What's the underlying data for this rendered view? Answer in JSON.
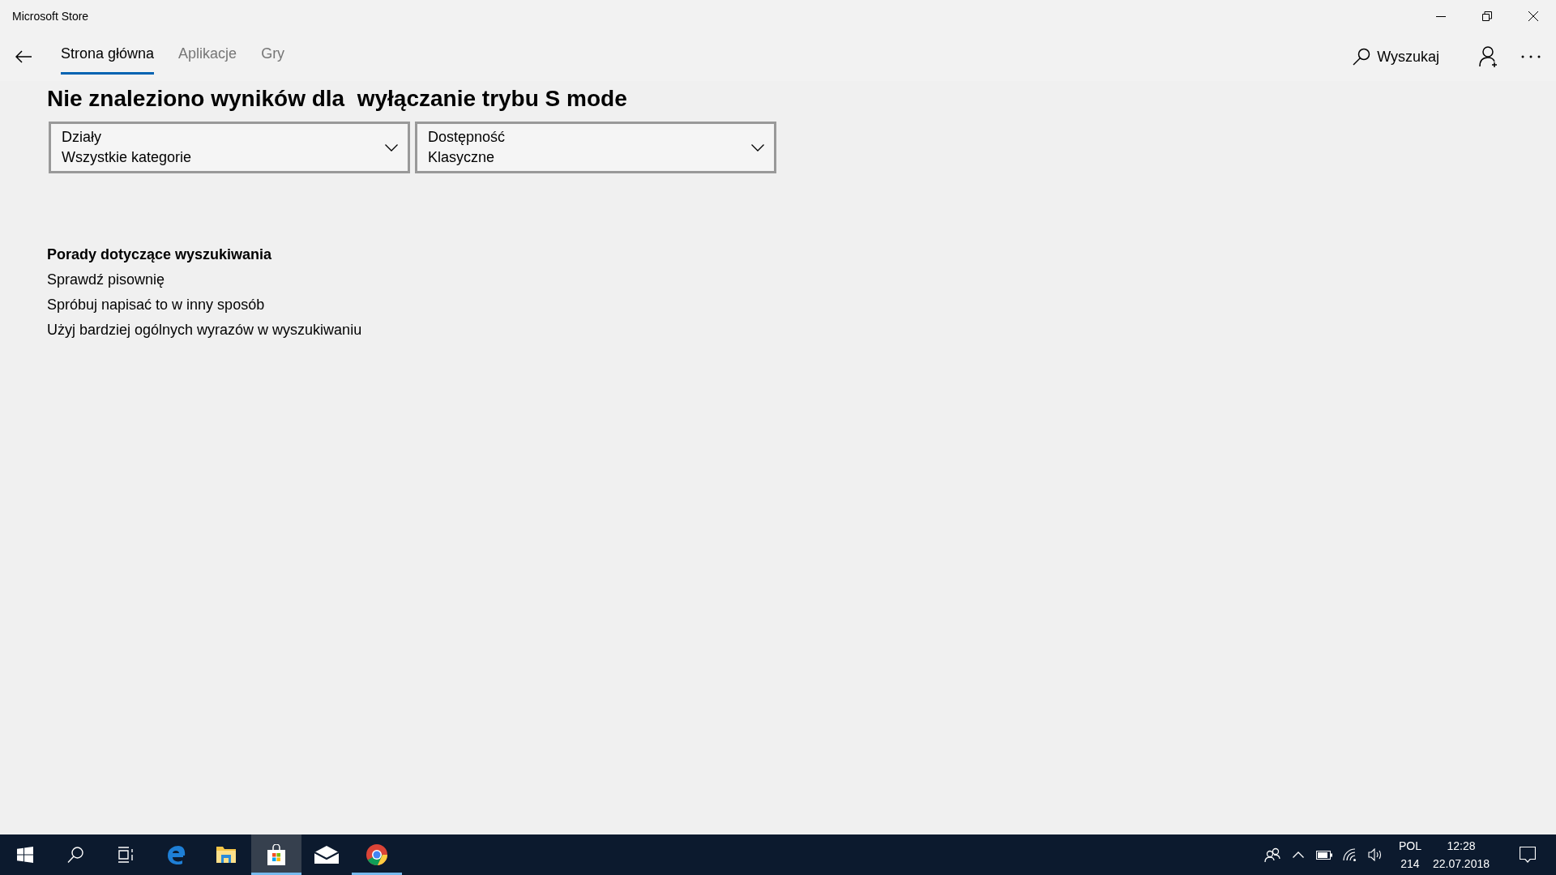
{
  "window": {
    "title": "Microsoft Store"
  },
  "tabs": [
    {
      "label": "Strona główna",
      "selected": true
    },
    {
      "label": "Aplikacje",
      "selected": false
    },
    {
      "label": "Gry",
      "selected": false
    }
  ],
  "search": {
    "label": "Wyszukaj"
  },
  "heading": "Nie znaleziono wyników dla  wyłączanie trybu S mode",
  "filters": [
    {
      "label": "Działy",
      "value": "Wszystkie kategorie"
    },
    {
      "label": "Dostępność",
      "value": "Klasyczne"
    }
  ],
  "tips": {
    "title": "Porady dotyczące wyszukiwania",
    "items": [
      "Sprawdź pisownię",
      "Spróbuj napisać to w inny sposób",
      "Użyj bardziej ogólnych wyrazów w wyszukiwaniu"
    ]
  },
  "taskbar": {
    "apps": [
      {
        "kind": "start",
        "active": false,
        "running": false
      },
      {
        "kind": "search",
        "active": false,
        "running": false
      },
      {
        "kind": "taskview",
        "active": false,
        "running": false
      },
      {
        "kind": "edge",
        "active": false,
        "running": false
      },
      {
        "kind": "explorer",
        "active": false,
        "running": false
      },
      {
        "kind": "store",
        "active": true,
        "running": true
      },
      {
        "kind": "mail",
        "active": false,
        "running": false
      },
      {
        "kind": "chrome",
        "active": false,
        "running": true
      }
    ],
    "language": "POL",
    "keyboard": "214",
    "time": "12:28",
    "date": "22.07.2018"
  }
}
